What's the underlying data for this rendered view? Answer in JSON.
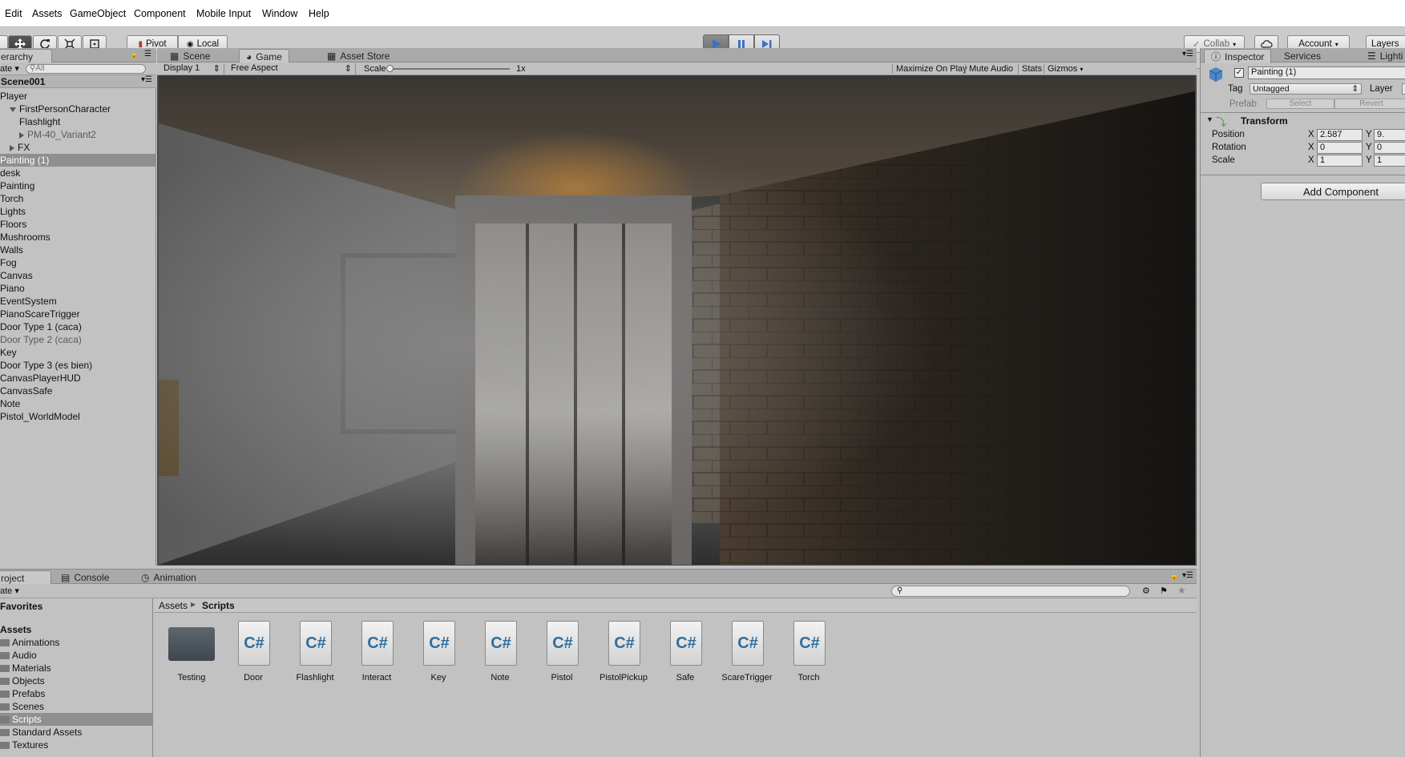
{
  "menu": [
    "Edit",
    "Assets",
    "GameObject",
    "Component",
    "Mobile Input",
    "Window",
    "Help"
  ],
  "toolbar": {
    "pivot": "Pivot",
    "local": "Local",
    "collab": "Collab",
    "account": "Account",
    "layers": "Layers"
  },
  "hierarchy": {
    "tab": "erarchy",
    "create": "ate",
    "search_placeholder": "All",
    "scene": "Scene001",
    "items": [
      {
        "label": "Player",
        "depth": 0
      },
      {
        "label": "FirstPersonCharacter",
        "depth": 1,
        "expanded": true
      },
      {
        "label": "Flashlight",
        "depth": 2
      },
      {
        "label": "PM-40_Variant2",
        "depth": 2,
        "collapsed": true,
        "muted": true
      },
      {
        "label": "FX",
        "depth": 1,
        "collapsed": true
      },
      {
        "label": "Painting (1)",
        "depth": 0,
        "selected": true
      },
      {
        "label": "desk",
        "depth": 0
      },
      {
        "label": "Painting",
        "depth": 0
      },
      {
        "label": "Torch",
        "depth": 0
      },
      {
        "label": "Lights",
        "depth": 0
      },
      {
        "label": "Floors",
        "depth": 0
      },
      {
        "label": "Mushrooms",
        "depth": 0
      },
      {
        "label": "Walls",
        "depth": 0
      },
      {
        "label": "Fog",
        "depth": 0
      },
      {
        "label": "Canvas",
        "depth": 0
      },
      {
        "label": "Piano",
        "depth": 0
      },
      {
        "label": "EventSystem",
        "depth": 0
      },
      {
        "label": "PianoScareTrigger",
        "depth": 0
      },
      {
        "label": "Door Type 1 (caca)",
        "depth": 0
      },
      {
        "label": "Door Type 2 (caca)",
        "depth": 0,
        "muted": true
      },
      {
        "label": "Key",
        "depth": 0
      },
      {
        "label": "Door Type 3 (es bien)",
        "depth": 0
      },
      {
        "label": "CanvasPlayerHUD",
        "depth": 0
      },
      {
        "label": "CanvasSafe",
        "depth": 0
      },
      {
        "label": "Note",
        "depth": 0
      },
      {
        "label": "Pistol_WorldModel",
        "depth": 0
      }
    ]
  },
  "game": {
    "tabs": [
      "Scene",
      "Game",
      "Asset Store"
    ],
    "display": "Display 1",
    "aspect": "Free Aspect",
    "scale_label": "Scale",
    "scale_value": "1x",
    "scale_slider_fraction": 0.0,
    "options": [
      "Maximize On Play",
      "Mute Audio",
      "Stats",
      "Gizmos"
    ]
  },
  "inspector": {
    "tabs": [
      "Inspector",
      "Services",
      "Lighti"
    ],
    "object_name": "Painting (1)",
    "tag_label": "Tag",
    "tag_value": "Untagged",
    "layer_label": "Layer",
    "prefab_label": "Prefab",
    "select": "Select",
    "revert": "Revert",
    "transform": "Transform",
    "rows": [
      {
        "label": "Position",
        "x": "2.587",
        "y": "9."
      },
      {
        "label": "Rotation",
        "x": "0",
        "y": "0"
      },
      {
        "label": "Scale",
        "x": "1",
        "y": "1"
      }
    ],
    "x_axis": "X",
    "y_axis": "Y",
    "add_component": "Add Component"
  },
  "project": {
    "tabs": [
      "roject",
      "Console",
      "Animation"
    ],
    "create": "ate",
    "favorites": "Favorites",
    "assets_root": "Assets",
    "folders": [
      "Animations",
      "Audio",
      "Materials",
      "Objects",
      "Prefabs",
      "Scenes",
      "Scripts",
      "Standard Assets",
      "Textures"
    ],
    "selected_folder": "Scripts",
    "breadcrumb": [
      "Assets",
      "Scripts"
    ],
    "items": [
      {
        "name": "Testing",
        "type": "folder"
      },
      {
        "name": "Door",
        "type": "cs"
      },
      {
        "name": "Flashlight",
        "type": "cs"
      },
      {
        "name": "Interact",
        "type": "cs"
      },
      {
        "name": "Key",
        "type": "cs"
      },
      {
        "name": "Note",
        "type": "cs"
      },
      {
        "name": "Pistol",
        "type": "cs"
      },
      {
        "name": "PistolPickup",
        "type": "cs"
      },
      {
        "name": "Safe",
        "type": "cs"
      },
      {
        "name": "ScareTrigger",
        "type": "cs"
      },
      {
        "name": "Torch",
        "type": "cs"
      }
    ],
    "cs_glyph": "C#"
  },
  "colors": {
    "accent": "#3a72c4",
    "selection": "#8f8f8f",
    "panel": "#c2c2c2"
  }
}
